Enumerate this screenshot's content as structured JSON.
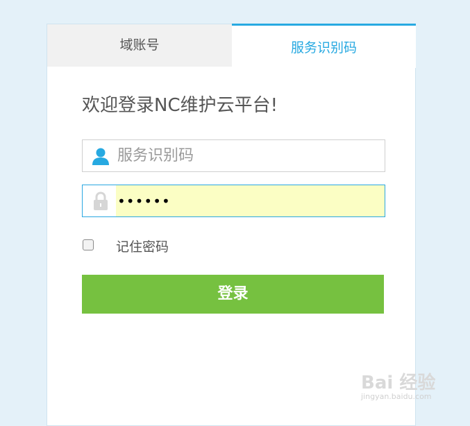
{
  "tabs": [
    {
      "label": "域账号",
      "active": false
    },
    {
      "label": "服务识别码",
      "active": true
    }
  ],
  "welcome_text": "欢迎登录NC维护云平台!",
  "user_field": {
    "placeholder": "服务识别码",
    "value": "",
    "icon": "user-icon"
  },
  "password_field": {
    "value": "••••••",
    "icon": "lock-icon"
  },
  "remember": {
    "label": "记住密码",
    "checked": false
  },
  "login_button": {
    "label": "登录"
  },
  "watermark": {
    "text": "Bai 经验",
    "sub": "jingyan.baidu.com"
  },
  "colors": {
    "accent": "#27a9e1",
    "button": "#76c140",
    "background": "#e4f1f9",
    "autofill": "#fbfec4"
  }
}
